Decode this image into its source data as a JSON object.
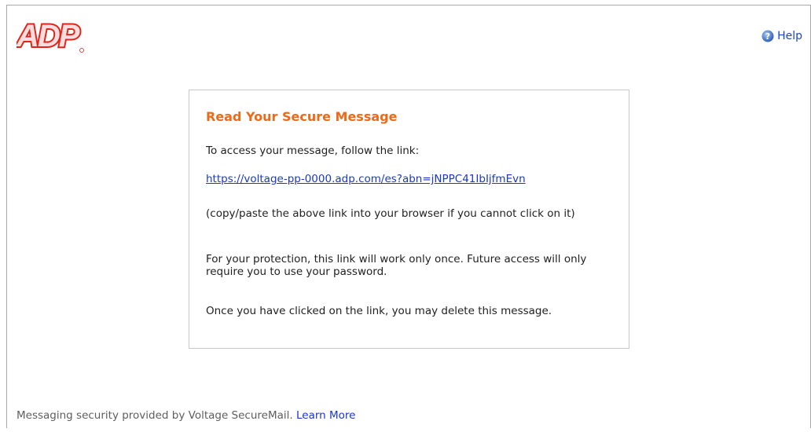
{
  "header": {
    "logo_text": "ADP",
    "help_label": "Help"
  },
  "message": {
    "title": "Read Your Secure Message",
    "intro": "To access your message, follow the link:",
    "link": "https://voltage-pp-0000.adp.com/es?abn=jNPPC41IbIjfmEvn",
    "copy_note": "(copy/paste the above link into your browser if you cannot click on it)",
    "protection_note": "For your protection, this link will work only once. Future access will only require you to use your password.",
    "delete_note": "Once you have clicked on the link, you may delete this message."
  },
  "footer": {
    "text": "Messaging security provided by Voltage SecureMail. ",
    "learn_more": "Learn More"
  },
  "colors": {
    "brand_red": "#e2231a",
    "title_orange": "#ec6a1a",
    "link_blue": "#1a39c4",
    "help_icon_blue": "#3a6fc9"
  }
}
